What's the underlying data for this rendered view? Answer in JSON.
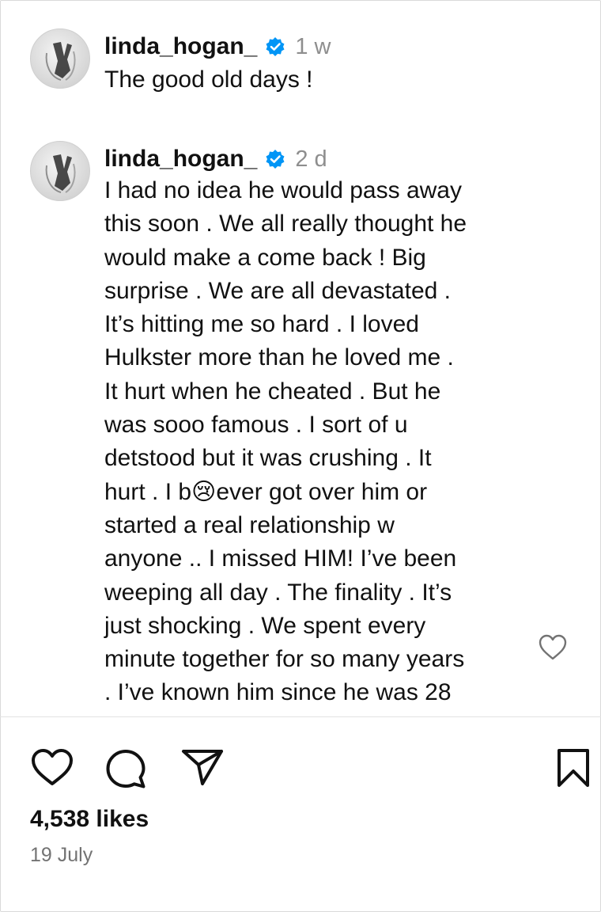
{
  "comments": [
    {
      "username": "linda_hogan_",
      "time": "1 w",
      "text": "The good old days !"
    },
    {
      "username": "linda_hogan_",
      "time": "2 d",
      "text": "I had no idea he would pass away\nthis soon . We all really thought he\nwould make a come back ! Big\nsurprise . We are all devastated .\nIt’s hitting me so hard . I loved\nHulkster more than he loved me .\nIt hurt when he cheated . But he\nwas sooo famous . I sort of u\ndetstood but it was crushing . It\nhurt . I b😢ever got over him or\nstarted a real relationship w\nanyone .. I missed HIM! I’ve been\nweeping all day . The finality . It’s\njust shocking . We spent every\nminute together for so many years\n. I’ve known him since he was 28"
    }
  ],
  "post": {
    "likes": "4,538 likes",
    "date": "19 July"
  },
  "colors": {
    "verified_badge": "#0095f6",
    "timestamp": "#8e8e8e",
    "text": "#111111"
  },
  "icons": {
    "avatar": "avatar",
    "verified": "verified-badge-icon",
    "comment_like": "heart-outline-icon",
    "like": "heart-icon",
    "comment": "comment-bubble-icon",
    "share": "paper-plane-icon",
    "save": "bookmark-icon"
  }
}
